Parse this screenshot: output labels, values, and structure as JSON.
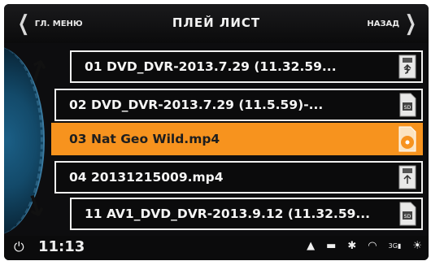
{
  "header": {
    "back_main_label": "ГЛ. МЕНЮ",
    "title": "ПЛЕЙ ЛИСТ",
    "back_label": "НАЗАД"
  },
  "playlist": {
    "items": [
      {
        "label": "01 DVD_DVR-2013.7.29 (11.32.59...",
        "icon": "usb-icon",
        "selected": false
      },
      {
        "label": "02 DVD_DVR-2013.7.29 (11.5.59)-...",
        "icon": "sd-card-icon",
        "selected": false
      },
      {
        "label": "03 Nat Geo Wild.mp4",
        "icon": "disc-file-icon",
        "selected": true
      },
      {
        "label": "04 20131215009.mp4",
        "icon": "usb-icon",
        "selected": false
      },
      {
        "label": "11 AV1_DVD_DVR-2013.9.12 (11.32.59...",
        "icon": "sd-card-icon",
        "selected": false
      }
    ]
  },
  "status": {
    "time": "11:13",
    "cellular_label": "3G"
  },
  "colors": {
    "accent": "#f7931e",
    "background": "#0d0d0f",
    "arc_blue": "#1b5f86"
  }
}
